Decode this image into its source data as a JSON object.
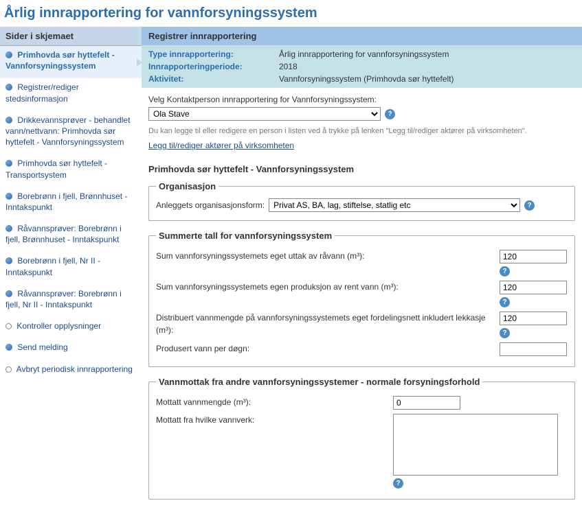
{
  "pageTitle": "Årlig innrapportering for vannforsyningssystem",
  "sidebar": {
    "header": "Sider i skjemaet",
    "items": [
      {
        "label": "Primhovda sør hyttefelt - Vannforsyningssystem",
        "active": true,
        "bullet": "solid"
      },
      {
        "label": "Registrer/rediger stedsinformasjon",
        "bullet": "solid"
      },
      {
        "label": "Drikkevannsprøver - behandlet vann/nettvann: Primhovda sør hyttefelt - Vannforsyningssystem",
        "bullet": "solid"
      },
      {
        "label": "Primhovda sør hyttefelt - Transportsystem",
        "bullet": "solid"
      },
      {
        "label": "Borebrønn i fjell, Brønnhuset - Inntakspunkt",
        "bullet": "solid"
      },
      {
        "label": "Råvannsprøver: Borebrønn i fjell, Brønnhuset - Inntakspunkt",
        "bullet": "solid"
      },
      {
        "label": "Borebrønn i fjell, Nr II - Inntakspunkt",
        "bullet": "solid"
      },
      {
        "label": "Råvannsprøver: Borebrønn i fjell, Nr II - Inntakspunkt",
        "bullet": "solid"
      },
      {
        "label": "Kontroller opplysninger",
        "bullet": "hollow"
      },
      {
        "label": "Send melding",
        "bullet": "solid"
      },
      {
        "label": "Avbryt periodisk innrapportering",
        "bullet": "hollow"
      }
    ]
  },
  "main": {
    "header": "Registrer innrapportering",
    "info": {
      "typeLabel": "Type innrapportering:",
      "typeValue": "Årlig innrapportering for vannforsyningssystem",
      "periodLabel": "Innrapporteringperiode:",
      "periodValue": "2018",
      "activityLabel": "Aktivitet:",
      "activityValue": "Vannforsyningssystem (Primhovda sør hyttefelt)"
    },
    "contact": {
      "label": "Velg Kontaktperson innrapportering for Vannforsyningssystem:",
      "selected": "Ola Stave",
      "hint": "Du kan legge til eller redigere en person i listen ved å trykke på lenken \"Legg til/rediger aktører på virksomheten\".",
      "link": "Legg til/rediger aktører på virksomheten"
    },
    "sectionTitle": "Primhovda sør hyttefelt - Vannforsyningssystem",
    "organisation": {
      "legend": "Organisasjon",
      "label": "Anleggets organisasjonsform:",
      "selected": "Privat AS, BA, lag, stiftelse, statlig etc"
    },
    "sums": {
      "legend": "Summerte tall for vannforsyningssystem",
      "row1": {
        "label": "Sum vannforsyningssystemets eget uttak av råvann (m³):",
        "value": "120"
      },
      "row2": {
        "label": "Sum vannforsyningssystemets egen produksjon av rent vann (m³):",
        "value": "120"
      },
      "row3": {
        "label": "Distribuert vannmengde på vannforsyningssystemets eget fordelingsnett inkludert lekkasje (m³):",
        "value": "120"
      },
      "row4": {
        "label": "Produsert vann per døgn:",
        "value": ""
      }
    },
    "intake": {
      "legend": "Vannmottak fra andre vannforsyningssystemer - normale forsyningsforhold",
      "row1": {
        "label": "Mottatt vannmengde (m³):",
        "value": "0"
      },
      "row2": {
        "label": "Mottatt fra hvilke vannverk:",
        "value": ""
      }
    }
  },
  "helpGlyph": "?"
}
